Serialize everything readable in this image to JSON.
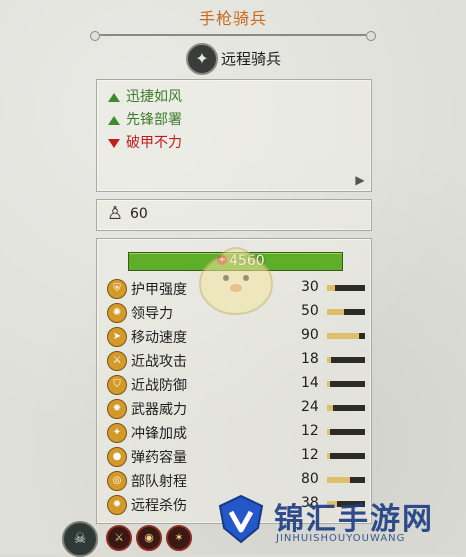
{
  "unit": {
    "title": "手枪骑兵",
    "class_name": "远程骑兵",
    "class_icon": "pistol-cavalry-icon"
  },
  "abilities": [
    {
      "label": "迅捷如风",
      "type": "positive"
    },
    {
      "label": "先锋部署",
      "type": "positive"
    },
    {
      "label": "破甲不力",
      "type": "negative"
    }
  ],
  "unit_size": {
    "value": "60",
    "icon": "soldier-icon"
  },
  "health": {
    "value": "4560",
    "fraction": 1.0,
    "color": "#5fae2a"
  },
  "stats": [
    {
      "label": "护甲强度",
      "value": "30",
      "fraction": 0.2,
      "icon": "armor-icon"
    },
    {
      "label": "领导力",
      "value": "50",
      "fraction": 0.45,
      "icon": "leadership-icon"
    },
    {
      "label": "移动速度",
      "value": "90",
      "fraction": 0.85,
      "icon": "speed-icon"
    },
    {
      "label": "近战攻击",
      "value": "18",
      "fraction": 0.1,
      "icon": "melee-attack-icon"
    },
    {
      "label": "近战防御",
      "value": "14",
      "fraction": 0.08,
      "icon": "melee-defence-icon"
    },
    {
      "label": "武器威力",
      "value": "24",
      "fraction": 0.15,
      "icon": "weapon-strength-icon"
    },
    {
      "label": "冲锋加成",
      "value": "12",
      "fraction": 0.07,
      "icon": "charge-bonus-icon"
    },
    {
      "label": "弹药容量",
      "value": "12",
      "fraction": 0.07,
      "icon": "ammo-icon"
    },
    {
      "label": "部队射程",
      "value": "80",
      "fraction": 0.6,
      "icon": "range-icon"
    },
    {
      "label": "远程杀伤",
      "value": "38",
      "fraction": 0.25,
      "icon": "missile-damage-icon"
    }
  ],
  "watermark": {
    "text": "锦汇手游网",
    "sub": "JINHUISHOUYOUWANG"
  },
  "colors": {
    "title": "#c86a1d",
    "positive": "#3d7d2a",
    "negative": "#bf1b1b",
    "stat_bar": "#e0bf6a"
  }
}
